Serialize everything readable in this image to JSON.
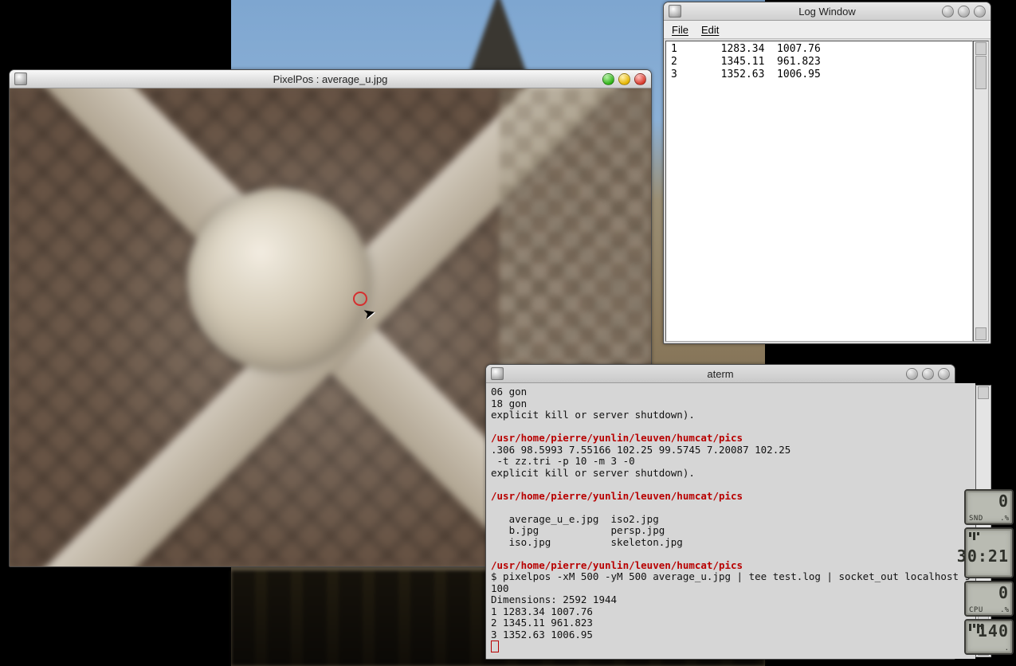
{
  "background": {
    "alt": "cathedral facade photograph"
  },
  "pixelpos": {
    "title": "PixelPos : average_u.jpg",
    "image_alt": "close-up of ribbed vault keystone, brick ceiling",
    "marker": {
      "color": "#d62f2f"
    },
    "traffic": {
      "green": true,
      "yellow": true,
      "red": true
    }
  },
  "log_window": {
    "title": "Log Window",
    "menu": {
      "file": "File",
      "edit": "Edit"
    },
    "rows": [
      {
        "idx": "1",
        "x": "1283.34",
        "y": "1007.76"
      },
      {
        "idx": "2",
        "x": "1345.11",
        "y": "961.823"
      },
      {
        "idx": "3",
        "x": "1352.63",
        "y": "1006.95"
      }
    ]
  },
  "aterm": {
    "title": "aterm",
    "path": "/usr/home/pierre/yunlin/leuven/humcat/pics",
    "lines_top": [
      "06 gon",
      "18 gon",
      "explicit kill or server shutdown)."
    ],
    "lines_numbers": ".306 98.5993 7.55166 102.25 99.5745 7.20087 102.25",
    "lines_flags": " -t zz.tri -p 10 -m 3 -0",
    "lines_kill": "explicit kill or server shutdown).",
    "ls": [
      "   average_u_e.jpg  iso2.jpg",
      "   b.jpg            persp.jpg",
      "   iso.jpg          skeleton.jpg"
    ],
    "cmd": "$ pixelpos -xM 500 -yM 500 average_u.jpg | tee test.log | socket_out localhost 9",
    "cmd_cont": "100",
    "dims": "Dimensions: 2592 1944",
    "out": [
      "1 1283.34 1007.76",
      "2 1345.11 961.823",
      "3 1352.63 1006.95"
    ]
  },
  "gadgets": {
    "snd": {
      "value": "0",
      "label": "SND",
      "sub": ".%"
    },
    "clock": {
      "value": "30:21",
      "label": "",
      "sub": ""
    },
    "cpu": {
      "value": "0",
      "label": "CPU",
      "sub": ".%"
    },
    "net": {
      "value": "140",
      "label": "",
      "sub": "."
    }
  }
}
